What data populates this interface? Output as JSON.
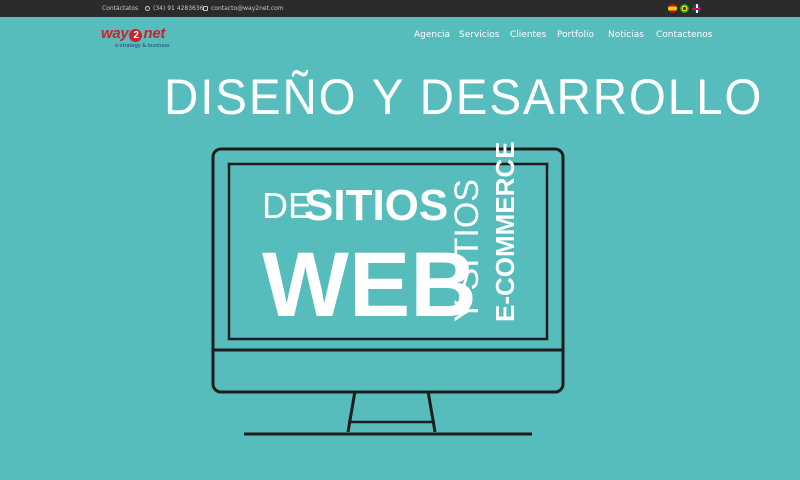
{
  "topbar": {
    "contact_label": "Contáctatos",
    "phone": "(34) 91 4283636",
    "email": "contacto@way2net.com"
  },
  "languages": [
    {
      "name": "es-flag-icon"
    },
    {
      "name": "br-flag-icon"
    },
    {
      "name": "uk-flag-icon"
    }
  ],
  "brand": {
    "name_before": "way",
    "name_digit": "2",
    "name_after": "net",
    "tagline": "e-strategy & business",
    "color": "#c9232b"
  },
  "nav": {
    "items": [
      {
        "label": "Agencia"
      },
      {
        "label": "Servicios"
      },
      {
        "label": "Clientes"
      },
      {
        "label": "Portfolio"
      },
      {
        "label": "Noticias"
      },
      {
        "label": "Contactenos"
      }
    ]
  },
  "hero": {
    "title": "DISEÑO Y DESARROLLO",
    "screen": {
      "de": "DE",
      "sitios": "SITIOS",
      "web": "WEB",
      "y_sitios": "Y SITIOS",
      "ecommerce": "E-COMMERCE"
    },
    "background": "#56bcbc"
  }
}
